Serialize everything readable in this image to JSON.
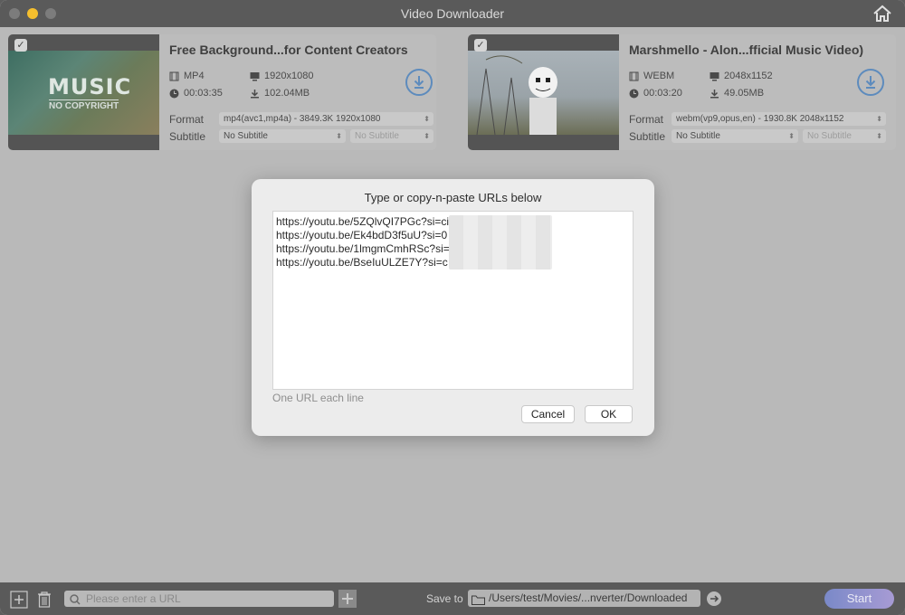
{
  "window": {
    "title": "Video Downloader"
  },
  "videos": [
    {
      "title": "Free Background...for Content Creators",
      "thumbnail_text_1": "MUSIC",
      "thumbnail_text_2": "NO COPYRIGHT",
      "container": "MP4",
      "resolution": "1920x1080",
      "duration": "00:03:35",
      "size": "102.04MB",
      "format_label": "Format",
      "format_value": "mp4(avc1,mp4a) - 3849.3K 1920x1080",
      "subtitle_label": "Subtitle",
      "subtitle_value": "No Subtitle",
      "subtitle_lang_value": "No Subtitle"
    },
    {
      "title": "Marshmello - Alon...fficial Music Video)",
      "container": "WEBM",
      "resolution": "2048x1152",
      "duration": "00:03:20",
      "size": "49.05MB",
      "format_label": "Format",
      "format_value": "webm(vp9,opus,en) - 1930.8K 2048x1152",
      "subtitle_label": "Subtitle",
      "subtitle_value": "No Subtitle",
      "subtitle_lang_value": "No Subtitle"
    }
  ],
  "modal": {
    "title": "Type or copy-n-paste URLs below",
    "urls": [
      "https://youtu.be/5ZQlvQI7PGc?si=ciZ",
      "https://youtu.be/Ek4bdD3f5uU?si=0",
      "https://youtu.be/1lmgmCmhRSc?si=",
      "https://youtu.be/BseIuULZE7Y?si=c"
    ],
    "hint": "One URL each line",
    "cancel_label": "Cancel",
    "ok_label": "OK"
  },
  "toolbar": {
    "url_placeholder": "Please enter a URL",
    "save_to_label": "Save to",
    "save_path": "/Users/test/Movies/...nverter/Downloaded",
    "start_label": "Start"
  },
  "colors": {
    "accent": "#5d8bbd",
    "start_gradient_from": "#7a89c8",
    "start_gradient_to": "#a79bd4"
  }
}
